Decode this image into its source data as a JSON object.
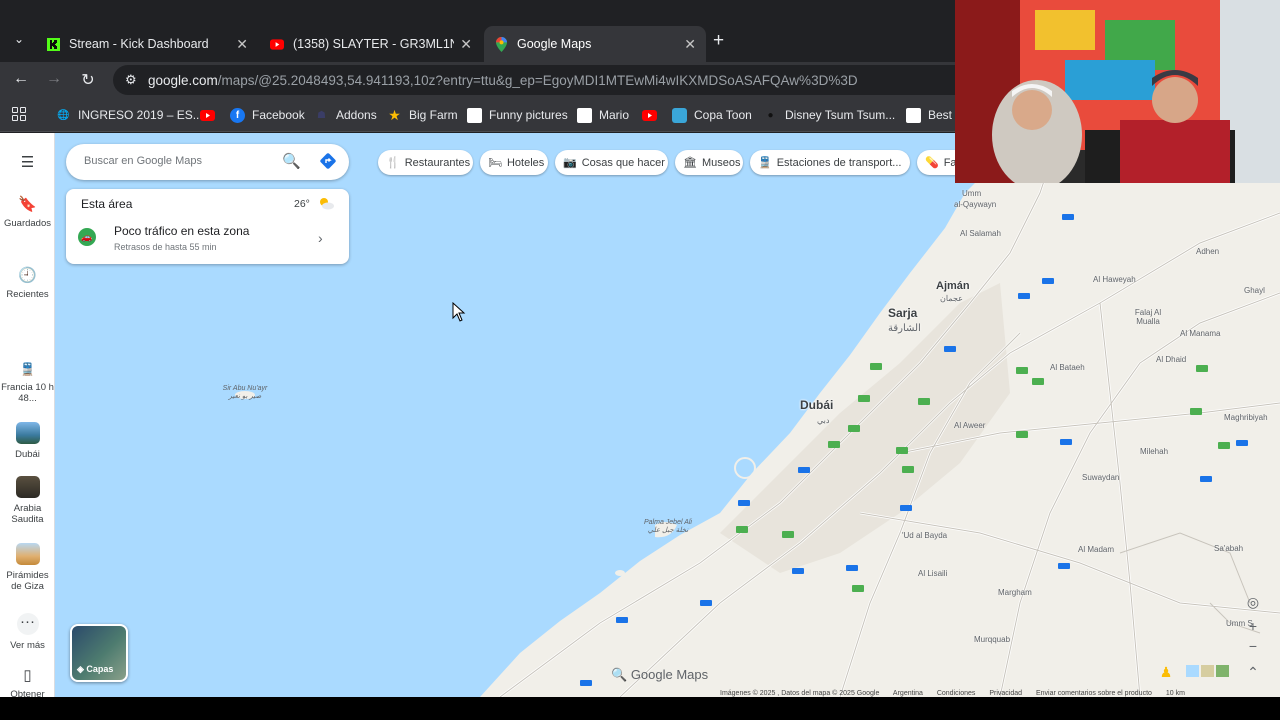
{
  "browser": {
    "tabs": [
      {
        "title": "Stream - Kick Dashboard",
        "favicon": "kick-icon",
        "active": false
      },
      {
        "title": "(1358) SLAYTER - GR3ML1N 🎒",
        "favicon": "youtube-icon",
        "active": false
      },
      {
        "title": "Google Maps",
        "favicon": "maps-pin-icon",
        "active": true
      }
    ],
    "url_host": "google.com",
    "url_rest": "/maps/@25.2048493,54.941193,10z?entry=ttu&g_ep=EgoyMDI1MTEwMi4wIKXMDSoASAFQAw%3D%3D",
    "bookmarks": [
      {
        "label": "INGRESO 2019 – ES...",
        "icon": "ingreso-icon"
      },
      {
        "label": "",
        "icon": "youtube-icon"
      },
      {
        "label": "Facebook",
        "icon": "facebook-icon"
      },
      {
        "label": "Addons",
        "icon": "addons-icon"
      },
      {
        "label": "Big Farm",
        "icon": "star-icon"
      },
      {
        "label": "Funny pictures",
        "icon": "page-icon"
      },
      {
        "label": "Mario",
        "icon": "page-icon"
      },
      {
        "label": "",
        "icon": "youtube-icon"
      },
      {
        "label": "Copa Toon",
        "icon": "copatoon-icon"
      },
      {
        "label": "Disney Tsum Tsum...",
        "icon": "disney-icon"
      },
      {
        "label": "Best v",
        "icon": "page-icon"
      }
    ]
  },
  "maps": {
    "search_placeholder": "Buscar en Google Maps",
    "area_card": {
      "title": "Esta área",
      "temperature": "26°",
      "traffic": "Poco tráfico en esta zona",
      "delays": "Retrasos de hasta 55 min"
    },
    "chips": [
      {
        "label": "Restaurantes",
        "icon": "fork-knife-icon"
      },
      {
        "label": "Hoteles",
        "icon": "bed-icon"
      },
      {
        "label": "Cosas que hacer",
        "icon": "camera-icon"
      },
      {
        "label": "Museos",
        "icon": "museum-icon"
      },
      {
        "label": "Estaciones de transport...",
        "icon": "train-icon"
      },
      {
        "label": "Far",
        "icon": "pharmacy-icon"
      }
    ],
    "sidebar": {
      "saved": "Guardados",
      "recent": "Recientes",
      "recent_places": [
        {
          "label": "Francia 10 h 48...",
          "icon": "train-icon"
        },
        {
          "label": "Dubái",
          "icon": "dubai-thumb"
        },
        {
          "label": "Arabia Saudita",
          "icon": "saudi-thumb"
        },
        {
          "label": "Pirámides de Giza",
          "icon": "giza-thumb"
        }
      ],
      "more": "Ver más",
      "get_app": "Obtener"
    },
    "layers_label": "Capas",
    "labels": {
      "sir_abu": "Sir Abu Nu'ayr",
      "sir_abu_ar": "صير بو نعير",
      "umm": "Umm",
      "al_qaywayn": "al-Qaywayn",
      "al_salamah": "Al Salamah",
      "ajman": "Ajmán",
      "ajman_ar": "عجمان",
      "sarja": "Sarja",
      "sarja_ar": "الشارقة",
      "dubai": "Dubái",
      "dubai_ar": "دبي",
      "adhen": "Adhen",
      "al_haweyah": "Al Haweyah",
      "ghayl": "Ghayl",
      "falaj": "Falaj Al Mualla",
      "al_manama": "Al Manama",
      "al_dhaid": "Al Dhaid",
      "al_bataeh": "Al Bataeh",
      "maghribiyah": "Maghribiyah",
      "al_aweer": "Al Aweer",
      "milehah": "Milehah",
      "suwaydan": "Suwaydan",
      "palma": "Palma Jebel Ali",
      "palma_ar": "نخلة جبل علي",
      "ud_al_bayda": "'Ud al Bayda",
      "al_lisaili": "Al Lisaili",
      "al_madam": "Al Madam",
      "saabah": "Sa'abah",
      "margham": "Margham",
      "murqquab": "Murqquab",
      "umm_s": "Umm S"
    },
    "logo": "Google Maps",
    "footer": [
      "Imágenes © 2025 , Datos del mapa © 2025 Google",
      "Argentina",
      "Condiciones",
      "Privacidad",
      "Enviar comentarios sobre el producto",
      "10 km"
    ]
  },
  "colors": {
    "water": "#aadaff",
    "land": "#f1efe9",
    "road_route": "#4caf50"
  }
}
